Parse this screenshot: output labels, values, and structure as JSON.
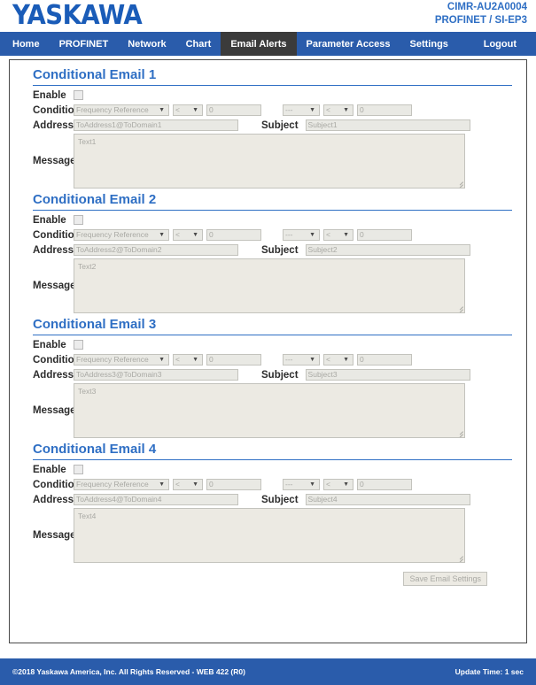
{
  "header": {
    "logo": "YASKAWA",
    "model": "CIMR-AU2A0004",
    "protocol": "PROFINET / SI-EP3"
  },
  "nav": {
    "items": [
      {
        "label": "Home",
        "active": false
      },
      {
        "label": "PROFINET",
        "active": false
      },
      {
        "label": "Network",
        "active": false
      },
      {
        "label": "Chart",
        "active": false
      },
      {
        "label": "Email Alerts",
        "active": true
      },
      {
        "label": "Parameter Access",
        "active": false
      },
      {
        "label": "Settings",
        "active": false
      }
    ],
    "logout": "Logout"
  },
  "labels": {
    "enable": "Enable",
    "condition": "Condition",
    "address": "Address",
    "subject": "Subject",
    "message": "Message"
  },
  "blocks": [
    {
      "title": "Conditional Email 1",
      "enabled": false,
      "source": "Frequency Reference",
      "operator1": "<",
      "value1": "0",
      "logic": "---",
      "operator2": "<",
      "value2": "0",
      "address": "ToAddress1@ToDomain1",
      "subject": "Subject1",
      "message": "Text1"
    },
    {
      "title": "Conditional Email 2",
      "enabled": false,
      "source": "Frequency Reference",
      "operator1": "<",
      "value1": "0",
      "logic": "---",
      "operator2": "<",
      "value2": "0",
      "address": "ToAddress2@ToDomain2",
      "subject": "Subject2",
      "message": "Text2"
    },
    {
      "title": "Conditional Email 3",
      "enabled": false,
      "source": "Frequency Reference",
      "operator1": "<",
      "value1": "0",
      "logic": "---",
      "operator2": "<",
      "value2": "0",
      "address": "ToAddress3@ToDomain3",
      "subject": "Subject3",
      "message": "Text3"
    },
    {
      "title": "Conditional Email 4",
      "enabled": false,
      "source": "Frequency Reference",
      "operator1": "<",
      "value1": "0",
      "logic": "---",
      "operator2": "<",
      "value2": "0",
      "address": "ToAddress4@ToDomain4",
      "subject": "Subject4",
      "message": "Text4"
    }
  ],
  "actions": {
    "save": "Save Email Settings"
  },
  "footer": {
    "copyright": "©2018 Yaskawa America, Inc. All Rights Reserved - WEB 422 (R0)",
    "update_time": "Update Time: 1 sec"
  },
  "colors": {
    "brand_blue": "#2a5cab",
    "link_blue": "#2f6fc4",
    "active_tab": "#3b3b3b",
    "control_bg": "#e9e9e4"
  }
}
